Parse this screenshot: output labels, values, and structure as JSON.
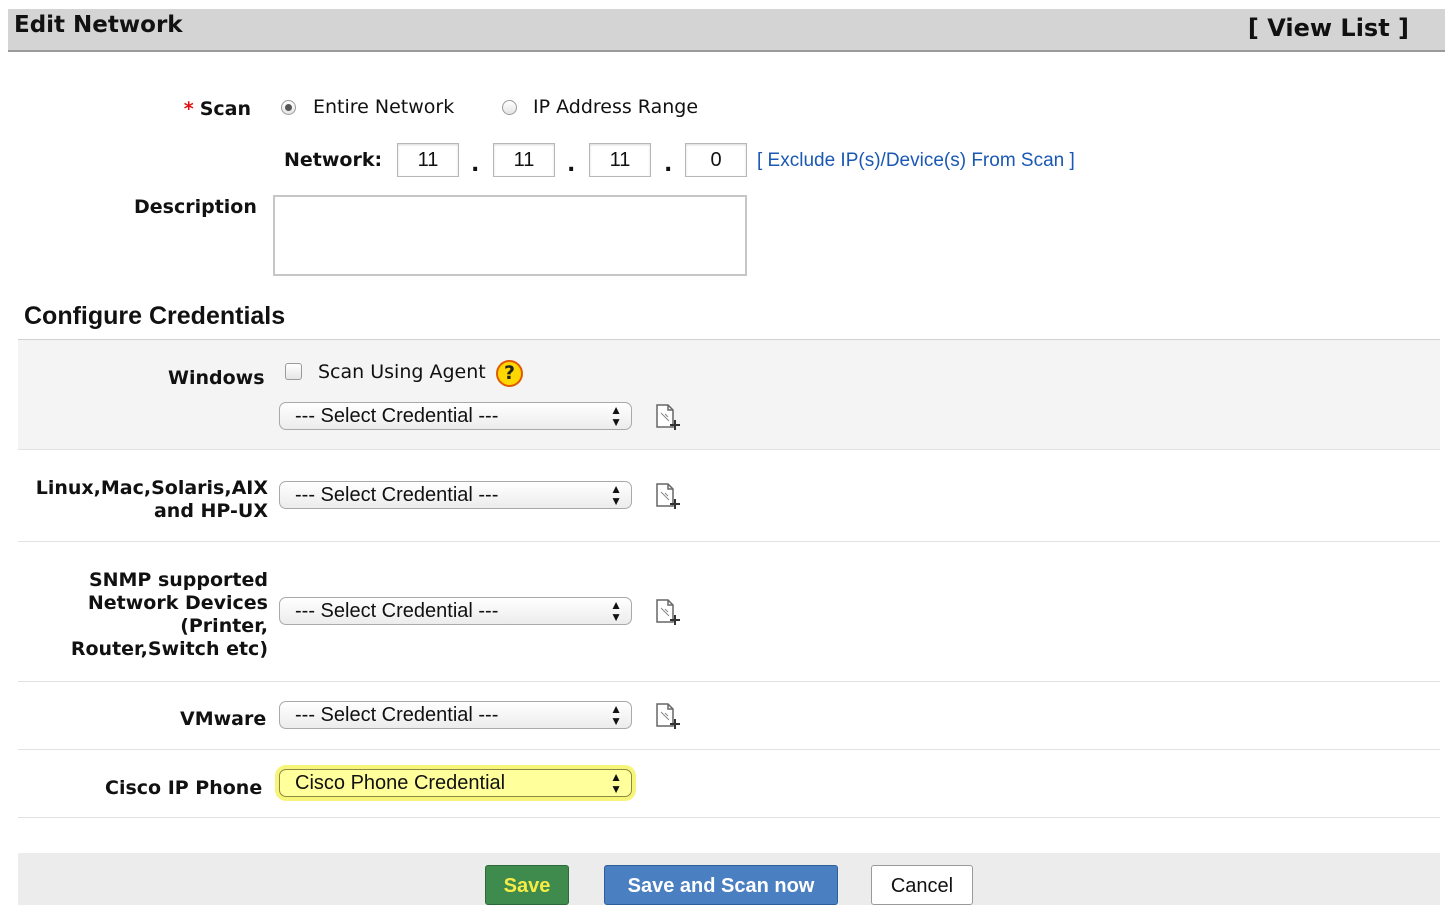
{
  "header": {
    "title": "Edit Network",
    "view_list": "[ View List ]"
  },
  "scan": {
    "required_mark": "*",
    "label": "Scan",
    "options": [
      {
        "label": "Entire Network",
        "selected": true
      },
      {
        "label": "IP Address Range",
        "selected": false
      }
    ],
    "network_label": "Network:",
    "octets": [
      "11",
      "11",
      "11",
      "0"
    ],
    "separator": ".",
    "exclude_link": "[ Exclude IP(s)/Device(s) From Scan ]"
  },
  "description": {
    "label": "Description",
    "value": ""
  },
  "credentials": {
    "title": "Configure Credentials",
    "scan_using_agent": "Scan Using Agent",
    "help_glyph": "?",
    "rows": [
      {
        "label": "Windows",
        "value": "--- Select Credential ---"
      },
      {
        "label_lines": [
          "Linux,Mac,Solaris,AIX",
          "and HP-UX"
        ],
        "value": "--- Select Credential ---"
      },
      {
        "label_lines": [
          "SNMP supported",
          "Network Devices",
          "(Printer,",
          "Router,Switch etc)"
        ],
        "value": "--- Select Credential ---"
      },
      {
        "label": "VMware",
        "value": "--- Select Credential ---"
      },
      {
        "label": "Cisco IP Phone",
        "value": "Cisco Phone Credential"
      }
    ]
  },
  "buttons": {
    "save": "Save",
    "save_scan": "Save and Scan now",
    "cancel": "Cancel"
  },
  "colors": {
    "link": "#1a58b4",
    "save_bg": "#3f8b4d",
    "scan_bg": "#4a7fc1",
    "highlight": "#f7f47a"
  },
  "icons": {
    "add_credential": "add-credential-icon",
    "help": "help-icon",
    "select_arrows": "select-arrows-icon"
  }
}
